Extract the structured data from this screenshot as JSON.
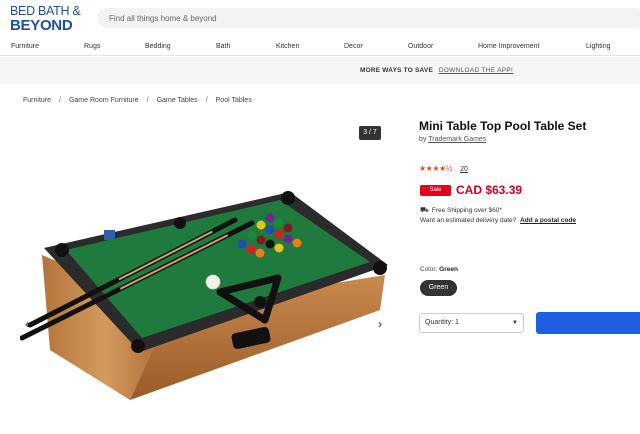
{
  "logo": {
    "line1": "BED BATH &",
    "line2": "BEYOND"
  },
  "search": {
    "placeholder": "Find all things home & beyond"
  },
  "nav": {
    "items": [
      "Furniture",
      "Rugs",
      "Bedding",
      "Bath",
      "Kitchen",
      "Decor",
      "Outdoor",
      "Home Improvement",
      "Lighting"
    ]
  },
  "promo": {
    "text": "MORE WAYS TO SAVE",
    "link": "DOWNLOAD THE APP!"
  },
  "breadcrumb": [
    "Furniture",
    "Game Room Furniture",
    "Game Tables",
    "Pool Tables"
  ],
  "gallery": {
    "counter": "3 / 7"
  },
  "product": {
    "title": "Mini Table Top Pool Table Set",
    "brand_prefix": "by",
    "brand": "Trademark Games",
    "rating": 4.5,
    "review_count": "20",
    "sale_label": "Sale",
    "price": "CAD $63.39",
    "shipping": "Free Shipping over $60*",
    "delivery_question": "Want an estimated delivery date?",
    "delivery_link": "Add a postal code",
    "color_label": "Color:",
    "color_value": "Green",
    "swatch_label": "Green",
    "quantity": "Quantity: 1"
  },
  "colors": {
    "accent": "#1d5fe0",
    "sale": "#e6001c",
    "brand": "#1f4f9d",
    "star": "#d9541e"
  }
}
